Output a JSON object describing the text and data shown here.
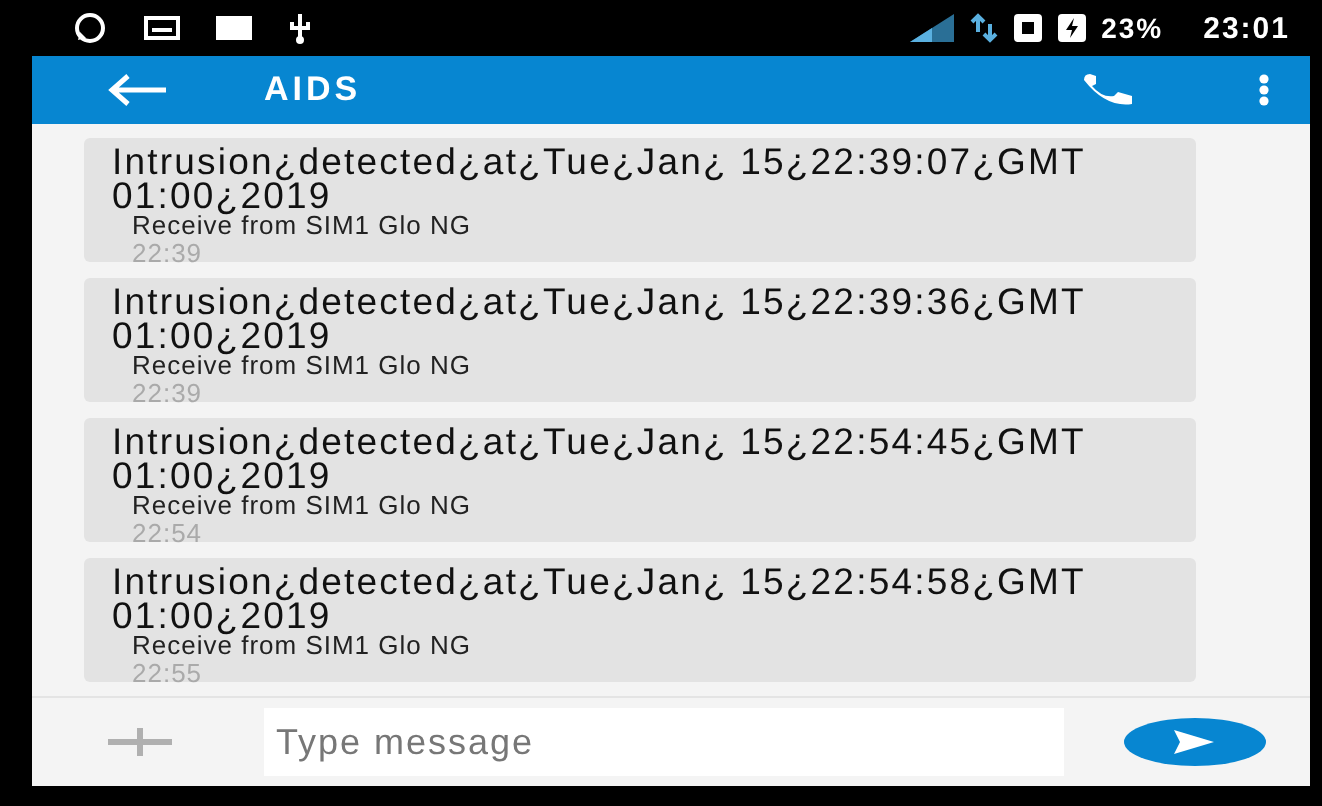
{
  "status_bar": {
    "battery": "23%",
    "time": "23:01"
  },
  "app_bar": {
    "title": "AIDS"
  },
  "messages": [
    {
      "text": "Intrusion¿detected¿at¿Tue¿Jan¿ 15¿22:39:07¿GMT 01:00¿2019",
      "sender": "Receive from SIM1 Glo NG",
      "time": "22:39"
    },
    {
      "text": "Intrusion¿detected¿at¿Tue¿Jan¿ 15¿22:39:36¿GMT 01:00¿2019",
      "sender": "Receive from SIM1 Glo NG",
      "time": "22:39"
    },
    {
      "text": "Intrusion¿detected¿at¿Tue¿Jan¿ 15¿22:54:45¿GMT 01:00¿2019",
      "sender": "Receive from SIM1 Glo NG",
      "time": "22:54"
    },
    {
      "text": "Intrusion¿detected¿at¿Tue¿Jan¿ 15¿22:54:58¿GMT 01:00¿2019",
      "sender": "Receive from SIM1 Glo NG",
      "time": "22:55"
    }
  ],
  "composer": {
    "placeholder": "Type message"
  }
}
